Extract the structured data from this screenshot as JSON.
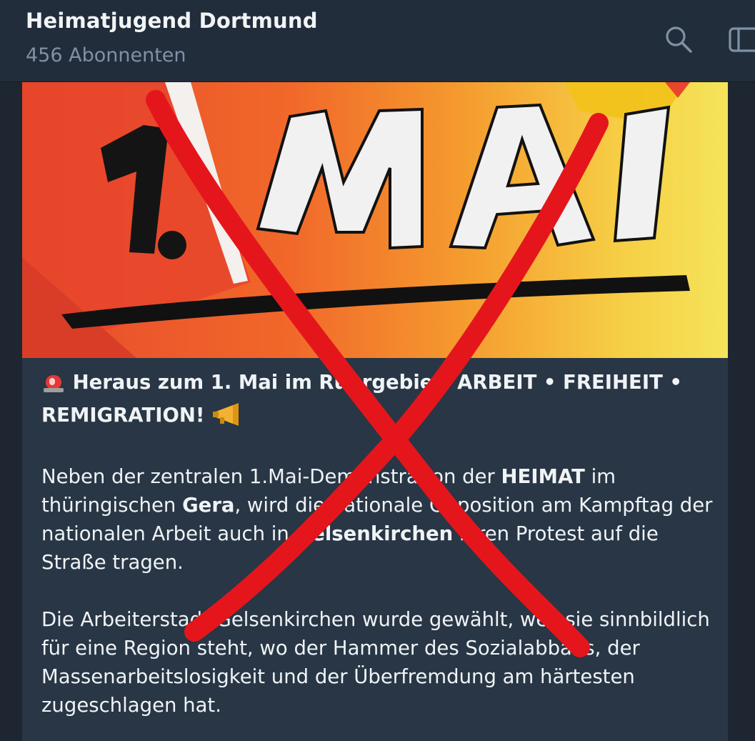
{
  "header": {
    "channel_name": "Heimatjugend Dortmund",
    "subscribers": "456 Abonnenten"
  },
  "icons": {
    "search": "search-icon",
    "sidebar": "sidebar-toggle-icon",
    "siren": "rotating-light-emoji",
    "megaphone": "megaphone-emoji"
  },
  "banner": {
    "text": "1.MAI"
  },
  "post": {
    "heading": "Heraus zum 1. Mai im Ruhrgebiet: ARBEIT • FREIHEIT • REMIGRATION!",
    "para1": {
      "t1": "Neben der zentralen 1.Mai-Demonstration der ",
      "b1": "HEIMAT",
      "t2": " im thüringischen ",
      "b2": "Gera",
      "t3": ", wird die nationale Opposition am Kampftag der nationalen Arbeit auch in ",
      "b3": "Gelsenkirchen",
      "t4": " ihren Protest auf die Straße tragen."
    },
    "para2": "Die Arbeiterstadt Gelsenkirchen wurde gewählt, weil sie sinnbildlich für eine Region steht, wo der Hammer des Sozialabbaus, der Massenarbeitslosigkeit und der Überfremdung am härtesten zugeschlagen hat."
  },
  "colors": {
    "background": "#1e2631",
    "header": "#212d3b",
    "post_bubble": "#283645",
    "cross_red": "#e4161c"
  }
}
